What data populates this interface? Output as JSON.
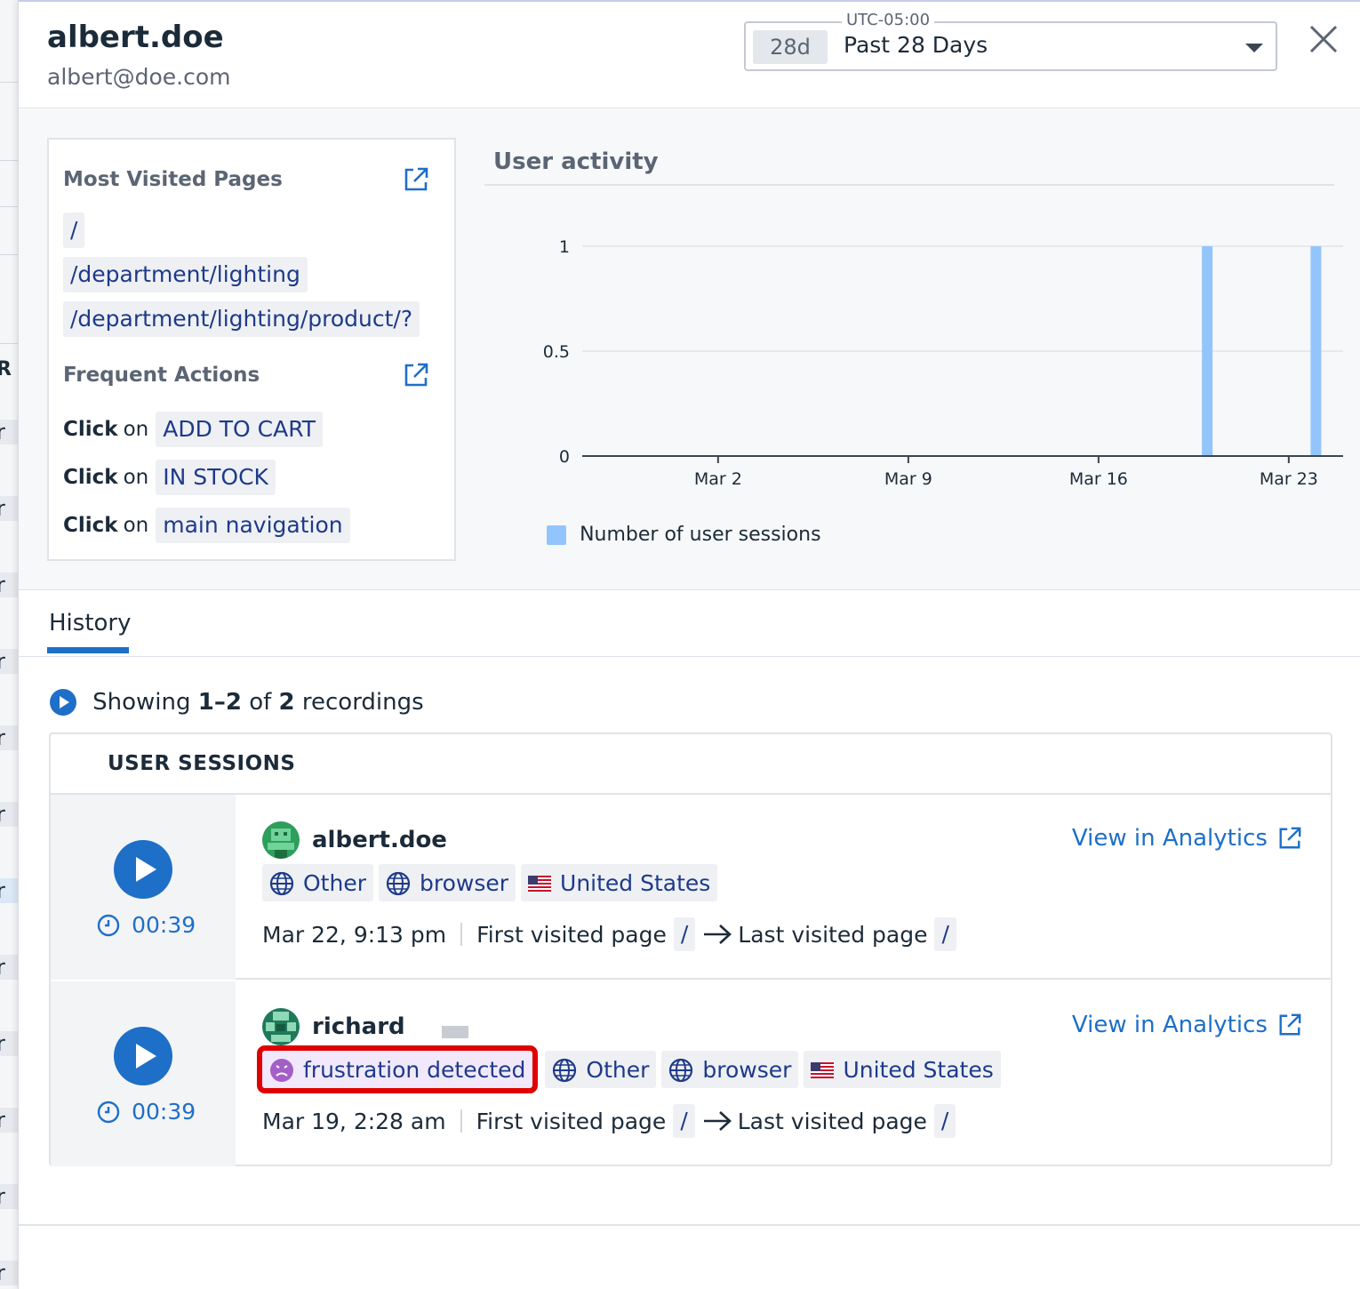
{
  "background_list": {
    "fragments": [
      "R",
      "r",
      "r",
      "r",
      "r",
      "r",
      "r",
      "r",
      "r",
      "r",
      "r",
      "r",
      "r",
      "r"
    ]
  },
  "header": {
    "user_name": "albert.doe",
    "user_email": "albert@doe.com",
    "timezone_label": "UTC-05:00",
    "range_badge": "28d",
    "range_label": "Past 28 Days"
  },
  "most_visited": {
    "title": "Most Visited Pages",
    "pages": [
      "/",
      "/department/lighting",
      "/department/lighting/product/?"
    ]
  },
  "frequent_actions": {
    "title": "Frequent Actions",
    "verb": "Click",
    "preposition": "on",
    "items": [
      "ADD TO CART",
      "IN STOCK",
      "main navigation"
    ]
  },
  "activity": {
    "title": "User activity",
    "legend": "Number of user sessions"
  },
  "chart_data": {
    "type": "bar",
    "title": "User activity",
    "xlabel": "",
    "ylabel": "",
    "x_ticks": [
      "Mar 2",
      "Mar 9",
      "Mar 16",
      "Mar 23"
    ],
    "x_tick_days": [
      1,
      8,
      15,
      22
    ],
    "y_ticks": [
      "0",
      "0.5",
      "1"
    ],
    "ylim": [
      0,
      1
    ],
    "x_domain_days": [
      -4,
      24
    ],
    "series": [
      {
        "name": "Number of user sessions",
        "color": "#93c5fd",
        "points": [
          {
            "date": "Mar 19",
            "day": 19,
            "value": 1
          },
          {
            "date": "Mar 23",
            "day": 23,
            "value": 1
          }
        ]
      }
    ],
    "grid": true,
    "legend_position": "bottom-left"
  },
  "tabs": [
    {
      "label": "History",
      "active": true
    }
  ],
  "showing": {
    "prefix": "Showing",
    "range": "1–2",
    "of": "of",
    "total": "2",
    "suffix": "recordings"
  },
  "sessions": {
    "header": "USER SESSIONS",
    "view_link": "View in Analytics",
    "first_label": "First visited page",
    "last_label": "Last visited page",
    "rows": [
      {
        "duration": "00:39",
        "user": "albert.doe",
        "frustration": "",
        "os": "Other",
        "browser": "browser",
        "country": "United States",
        "date": "Mar 22, 9:13 pm",
        "first_page": "/",
        "last_page": "/"
      },
      {
        "duration": "00:39",
        "user": "richard",
        "frustration": "frustration detected",
        "os": "Other",
        "browser": "browser",
        "country": "United States",
        "date": "Mar 19, 2:28 am",
        "first_page": "/",
        "last_page": "/"
      }
    ]
  },
  "colors": {
    "accent": "#1e6fc8",
    "bar": "#93c5fd",
    "highlight": "#e00000",
    "frustration_bg": "#f1e9fb"
  }
}
